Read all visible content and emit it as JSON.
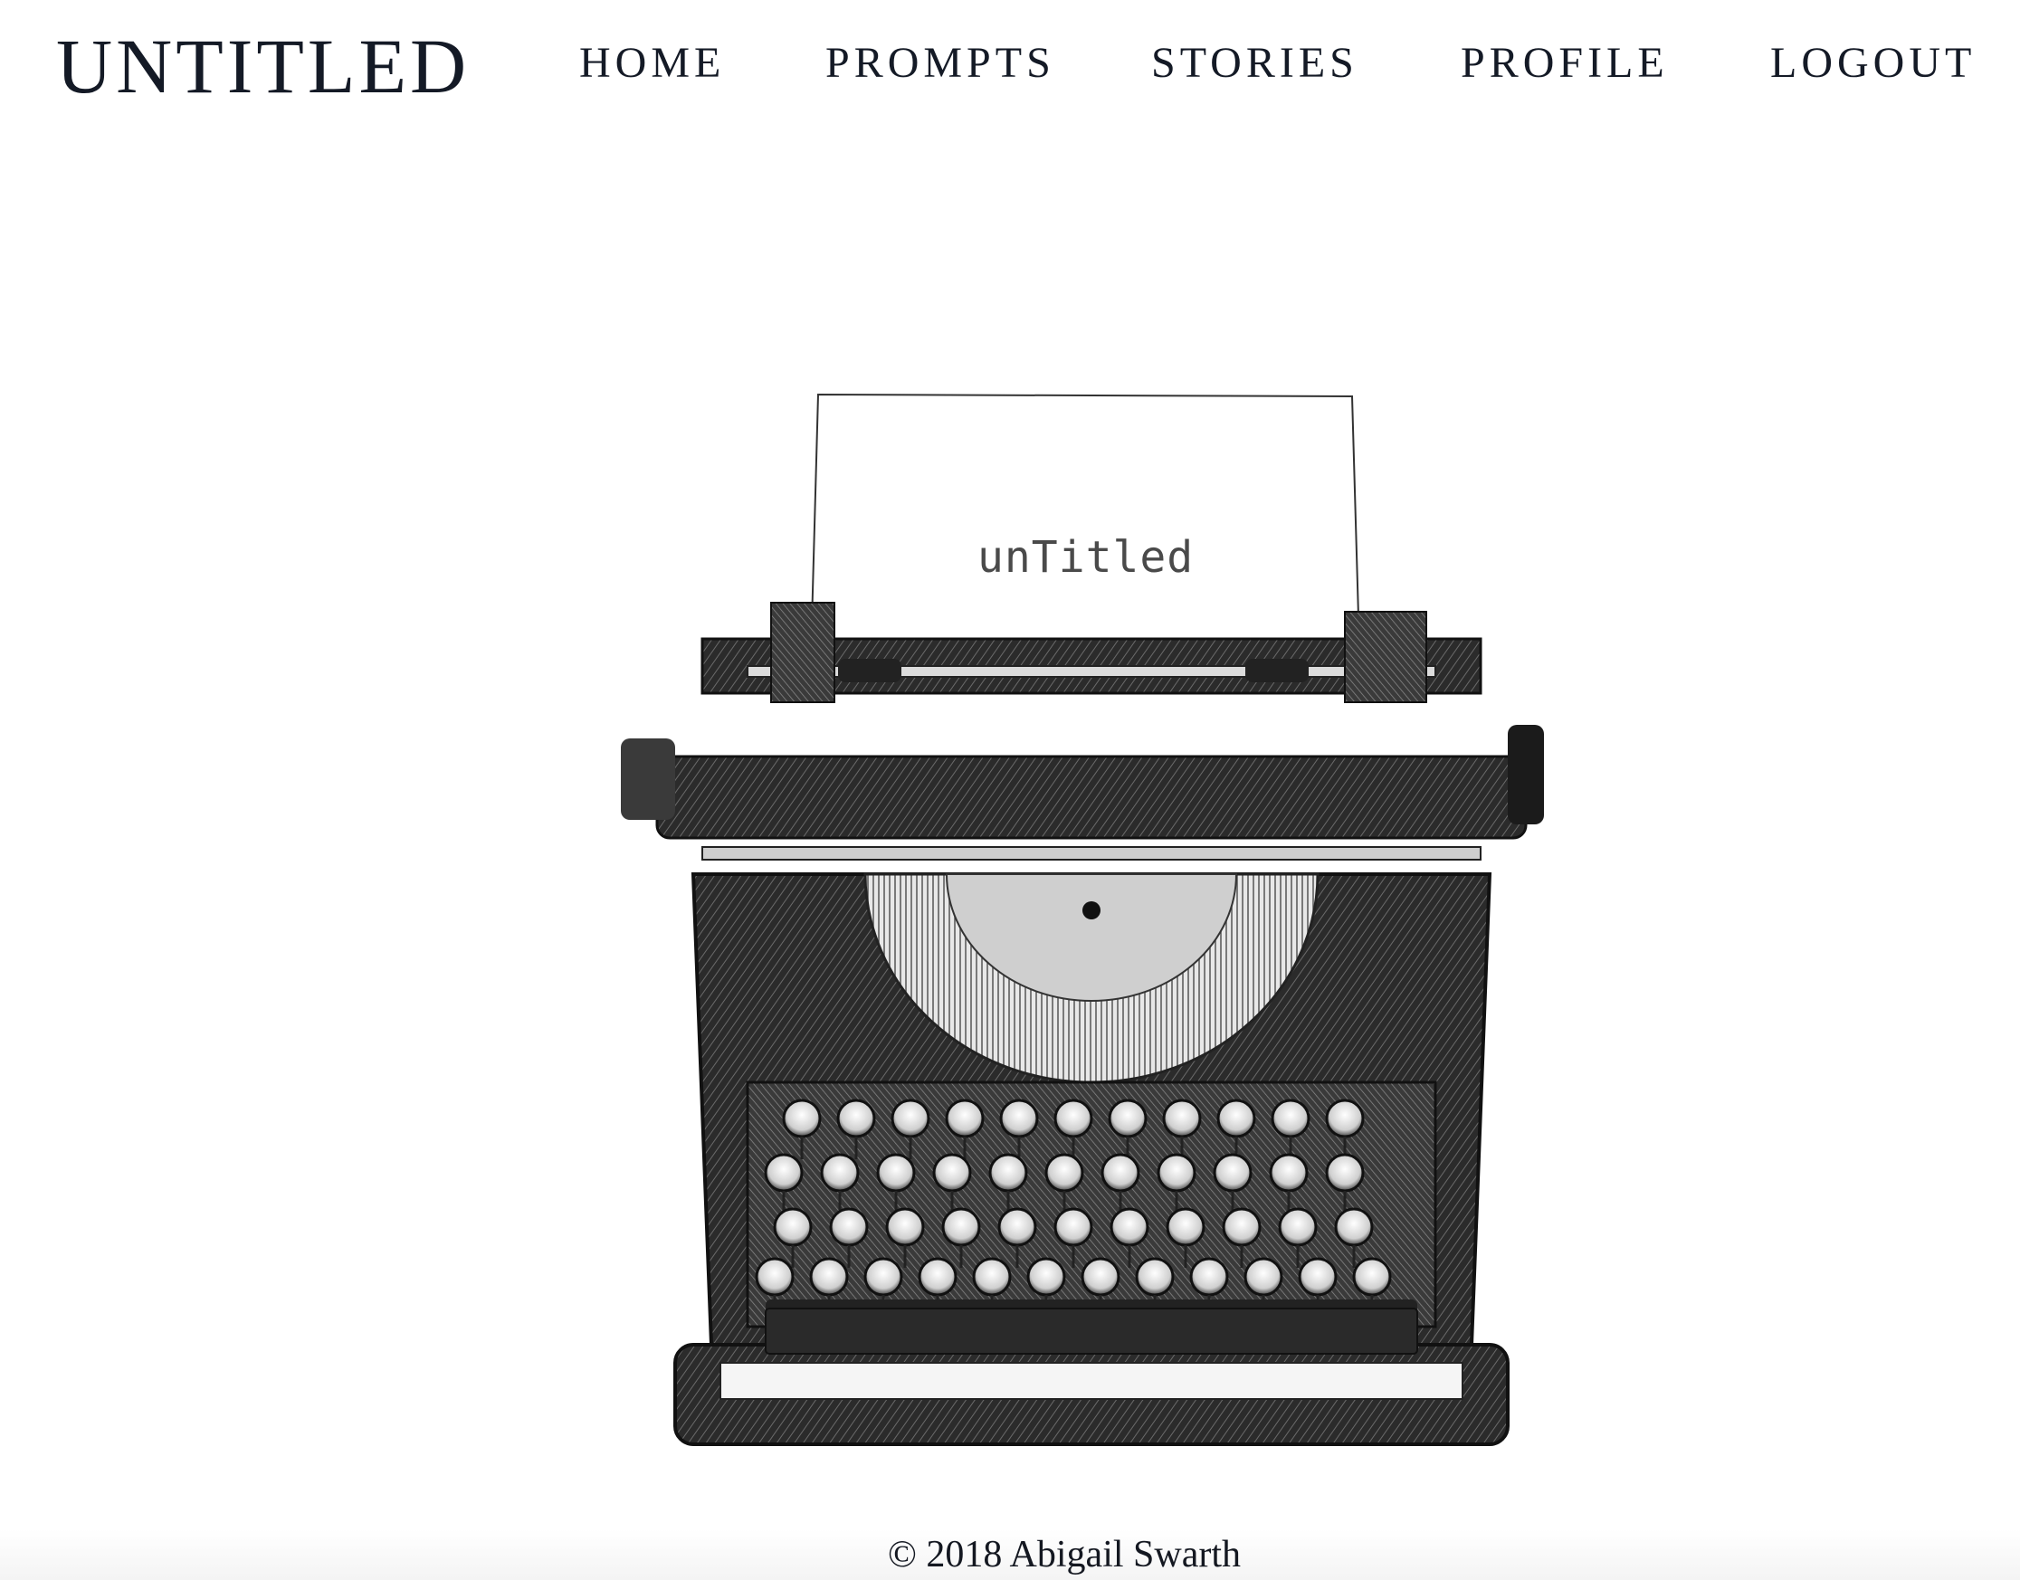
{
  "header": {
    "brand": "UNTITLED",
    "nav": [
      {
        "label": "HOME"
      },
      {
        "label": "PROMPTS"
      },
      {
        "label": "STORIES"
      },
      {
        "label": "PROFILE"
      },
      {
        "label": "LOGOUT"
      }
    ]
  },
  "hero": {
    "image_icon": "typewriter-illustration",
    "paper_text": "unTitled"
  },
  "footer": {
    "copyright": "© 2018 Abigail Swarth"
  },
  "colors": {
    "text": "#141a26",
    "background": "#ffffff",
    "ink": "#1e1e1e"
  }
}
